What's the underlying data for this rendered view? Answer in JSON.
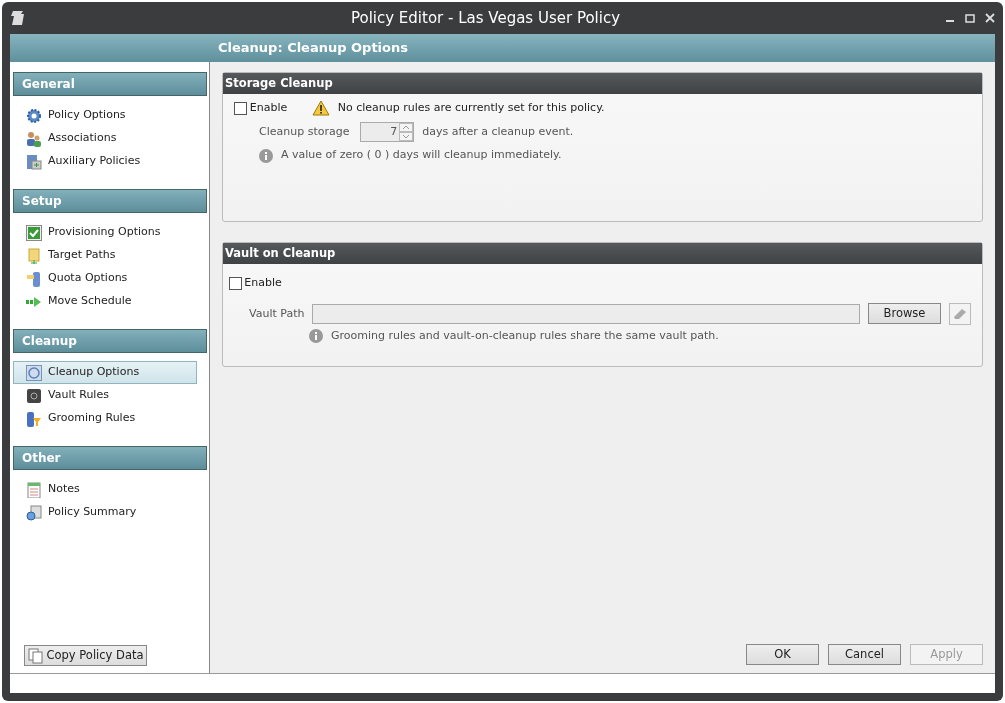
{
  "window": {
    "title": "Policy Editor - Las Vegas User Policy"
  },
  "header": {
    "title": "Cleanup: Cleanup Options"
  },
  "sidebar": {
    "sections": [
      {
        "title": "General",
        "items": [
          {
            "label": "Policy Options",
            "selected": false
          },
          {
            "label": "Associations",
            "selected": false
          },
          {
            "label": "Auxiliary Policies",
            "selected": false
          }
        ]
      },
      {
        "title": "Setup",
        "items": [
          {
            "label": "Provisioning Options",
            "selected": false
          },
          {
            "label": "Target Paths",
            "selected": false
          },
          {
            "label": "Quota Options",
            "selected": false
          },
          {
            "label": "Move Schedule",
            "selected": false
          }
        ]
      },
      {
        "title": "Cleanup",
        "items": [
          {
            "label": "Cleanup Options",
            "selected": true
          },
          {
            "label": "Vault Rules",
            "selected": false
          },
          {
            "label": "Grooming Rules",
            "selected": false
          }
        ]
      },
      {
        "title": "Other",
        "items": [
          {
            "label": "Notes",
            "selected": false
          },
          {
            "label": "Policy Summary",
            "selected": false
          }
        ]
      }
    ],
    "copy_button": "Copy Policy Data"
  },
  "storage_cleanup": {
    "title": "Storage Cleanup",
    "enable": {
      "label": "Enable",
      "checked": false
    },
    "warning": "No cleanup rules are currently set for this policy.",
    "storage_label": "Cleanup storage",
    "storage_value": "7",
    "storage_disabled": true,
    "storage_suffix": "days after a cleanup event.",
    "info": "A value of zero ( 0 ) days will cleanup immediately."
  },
  "vault_on_cleanup": {
    "title": "Vault on Cleanup",
    "enable": {
      "label": "Enable",
      "checked": false
    },
    "path_label": "Vault Path",
    "path_disabled": true,
    "browse_button": "Browse",
    "info": "Grooming rules and vault-on-cleanup rules share the same vault path."
  },
  "buttons": [
    {
      "label": "OK",
      "disabled": false
    },
    {
      "label": "Cancel",
      "disabled": false
    },
    {
      "label": "Apply",
      "disabled": true
    }
  ]
}
